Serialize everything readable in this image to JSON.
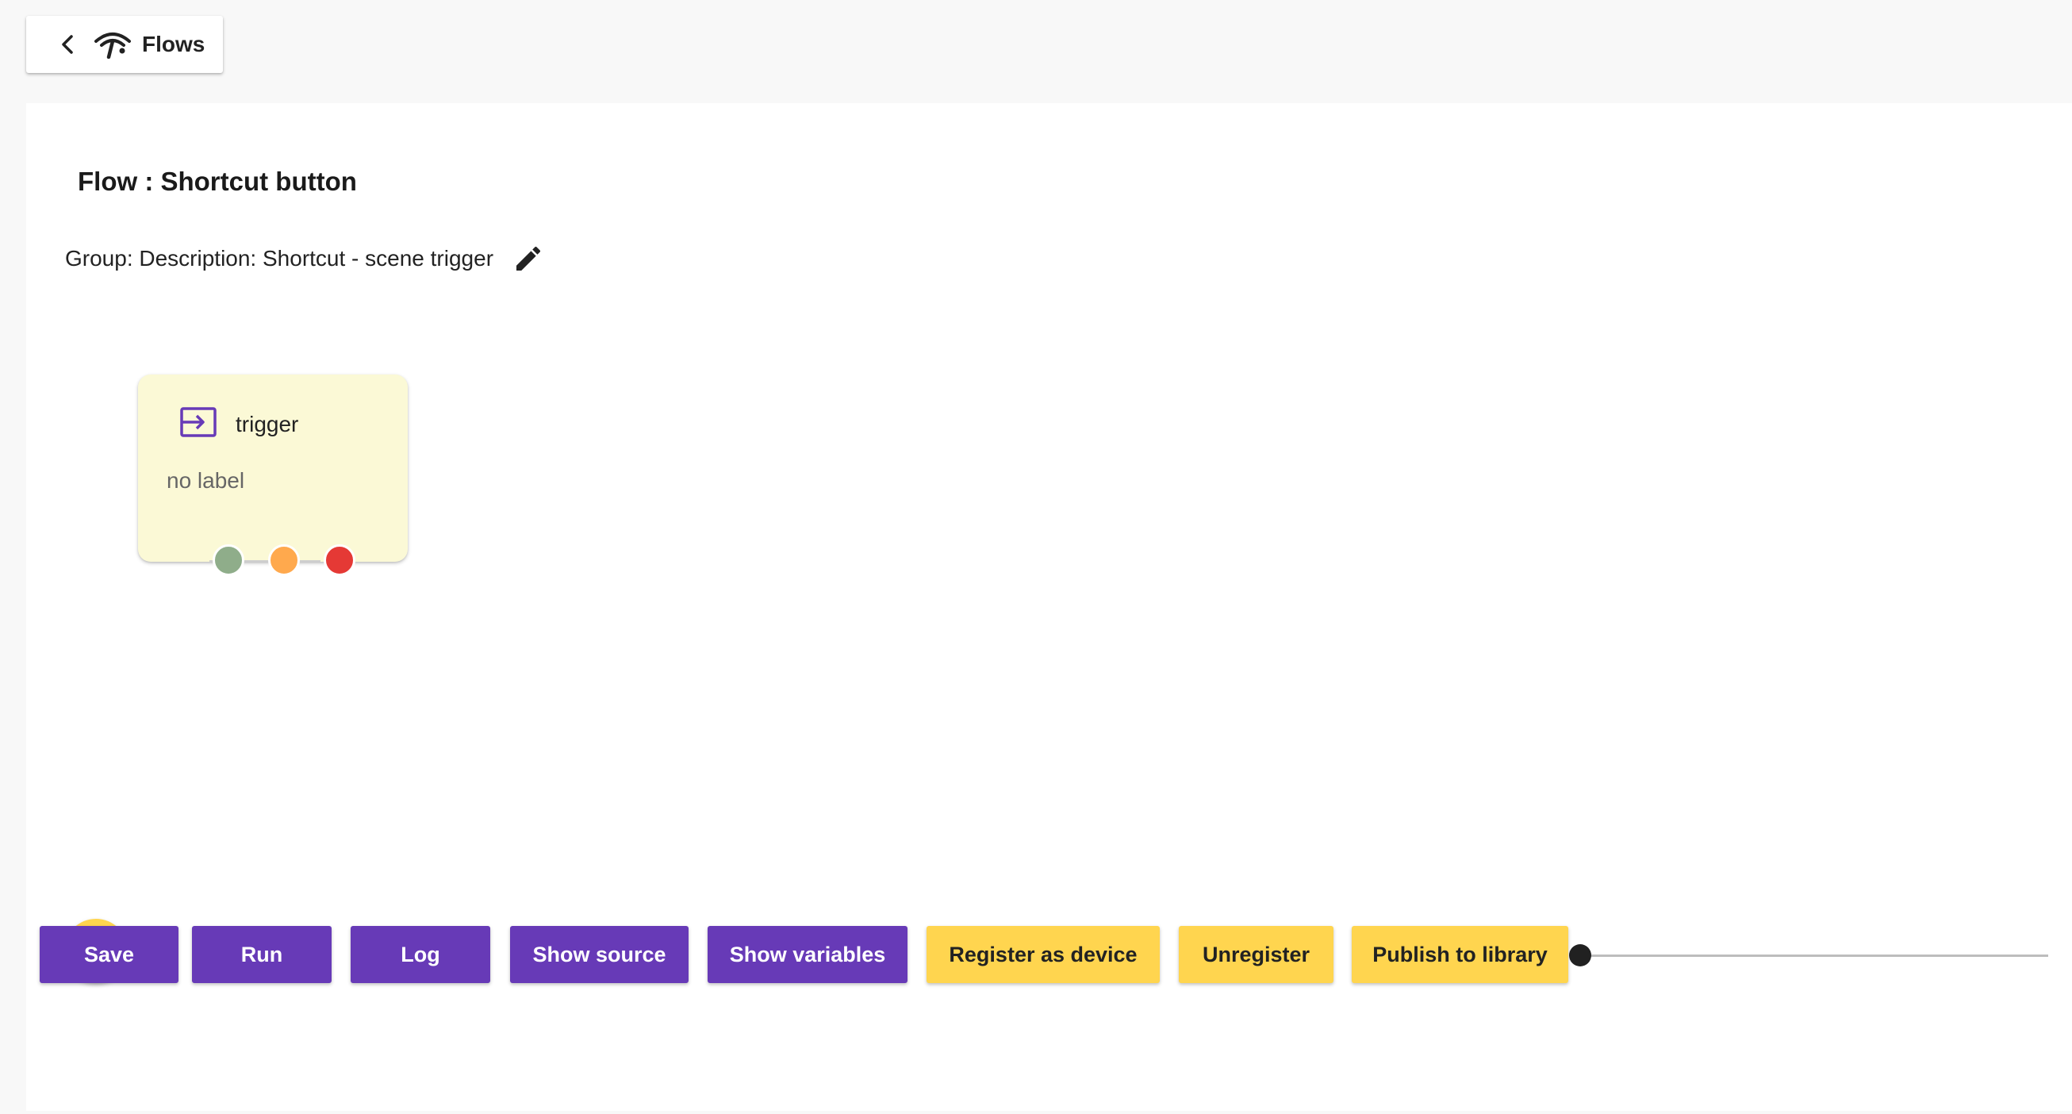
{
  "header": {
    "back_label": "Flows",
    "back_icon": "chevron-left-icon",
    "logo_icon": "wifi-antenna-logo-icon"
  },
  "flow": {
    "title": "Flow : Shortcut button",
    "description_line": "Group: Description: Shortcut - scene trigger",
    "edit_icon": "pencil-icon"
  },
  "canvas": {
    "nodes": [
      {
        "name": "trigger",
        "label": "no label",
        "icon": "input-arrow-icon",
        "ports": [
          {
            "name": "success",
            "color": "#8fad8a"
          },
          {
            "name": "warning",
            "color": "#ffa94d"
          },
          {
            "name": "error",
            "color": "#e53935"
          }
        ]
      }
    ]
  },
  "fab": {
    "icon": "plus-icon"
  },
  "toolbar": {
    "save": "Save",
    "run": "Run",
    "log": "Log",
    "show_source": "Show source",
    "show_variables": "Show variables",
    "register_device": "Register as device",
    "unregister": "Unregister",
    "publish": "Publish to library"
  },
  "zoom_slider": {
    "value": 0
  },
  "colors": {
    "primary": "#673ab7",
    "accent": "#ffd54f",
    "node_background": "#fbf9d6",
    "page_background": "#f8f8f8"
  }
}
